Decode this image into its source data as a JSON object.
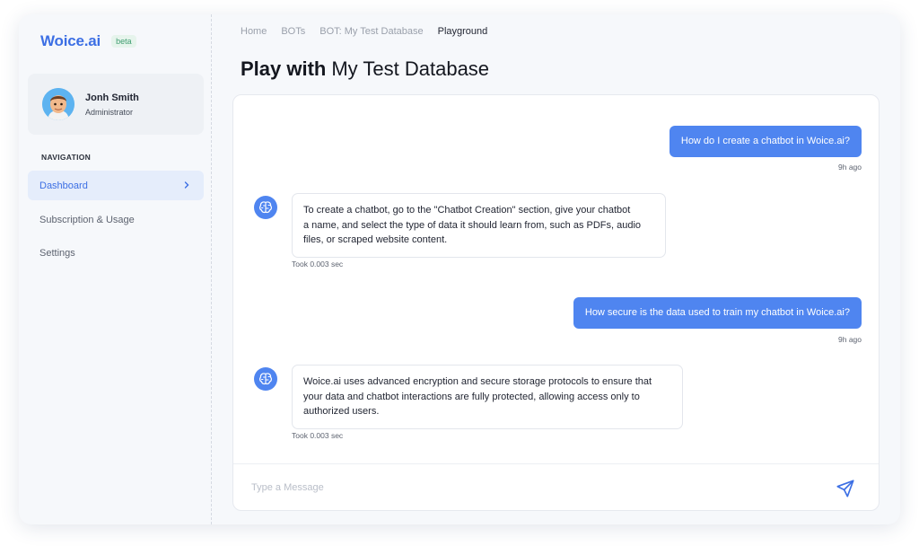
{
  "brand": {
    "name": "Woice.ai",
    "badge": "beta"
  },
  "user": {
    "name": "Jonh Smith",
    "role": "Administrator"
  },
  "navigation": {
    "heading": "NAVIGATION",
    "items": [
      {
        "label": "Dashboard",
        "active": true
      },
      {
        "label": "Subscription & Usage",
        "active": false
      },
      {
        "label": "Settings",
        "active": false
      }
    ]
  },
  "breadcrumb": [
    "Home",
    "BOTs",
    "BOT: My Test Database",
    "Playground"
  ],
  "page_title": {
    "bold": "Play with",
    "rest": "My Test Database"
  },
  "messages": [
    {
      "role": "user",
      "text": "How do I create a chatbot in Woice.ai?",
      "time": "9h ago"
    },
    {
      "role": "bot",
      "lines": [
        "To create a chatbot, go to the \"Chatbot Creation\" section, give your chatbot",
        "a name, and select the type of data it should learn from, such as PDFs, audio",
        "files, or scraped website content."
      ],
      "meta": "Took 0.003 sec"
    },
    {
      "role": "user",
      "text": "How secure is the data used to train my chatbot in Woice.ai?",
      "time": "9h ago"
    },
    {
      "role": "bot",
      "lines": [
        "Woice.ai uses advanced encryption and secure storage protocols to ensure that",
        "your data and chatbot interactions are fully protected, allowing access only to",
        "authorized users."
      ],
      "meta": "Took 0.003 sec"
    }
  ],
  "composer": {
    "placeholder": "Type a Message"
  },
  "icons": {
    "nav_chevron": "chevron-right-icon",
    "bot": "brain-icon",
    "send": "send-icon",
    "avatar": "memoji-avatar"
  },
  "colors": {
    "accent": "#4f85f0",
    "brand": "#3c6fe4",
    "badge_text": "#3f9d70",
    "active_nav_bg": "#e5edfb"
  }
}
